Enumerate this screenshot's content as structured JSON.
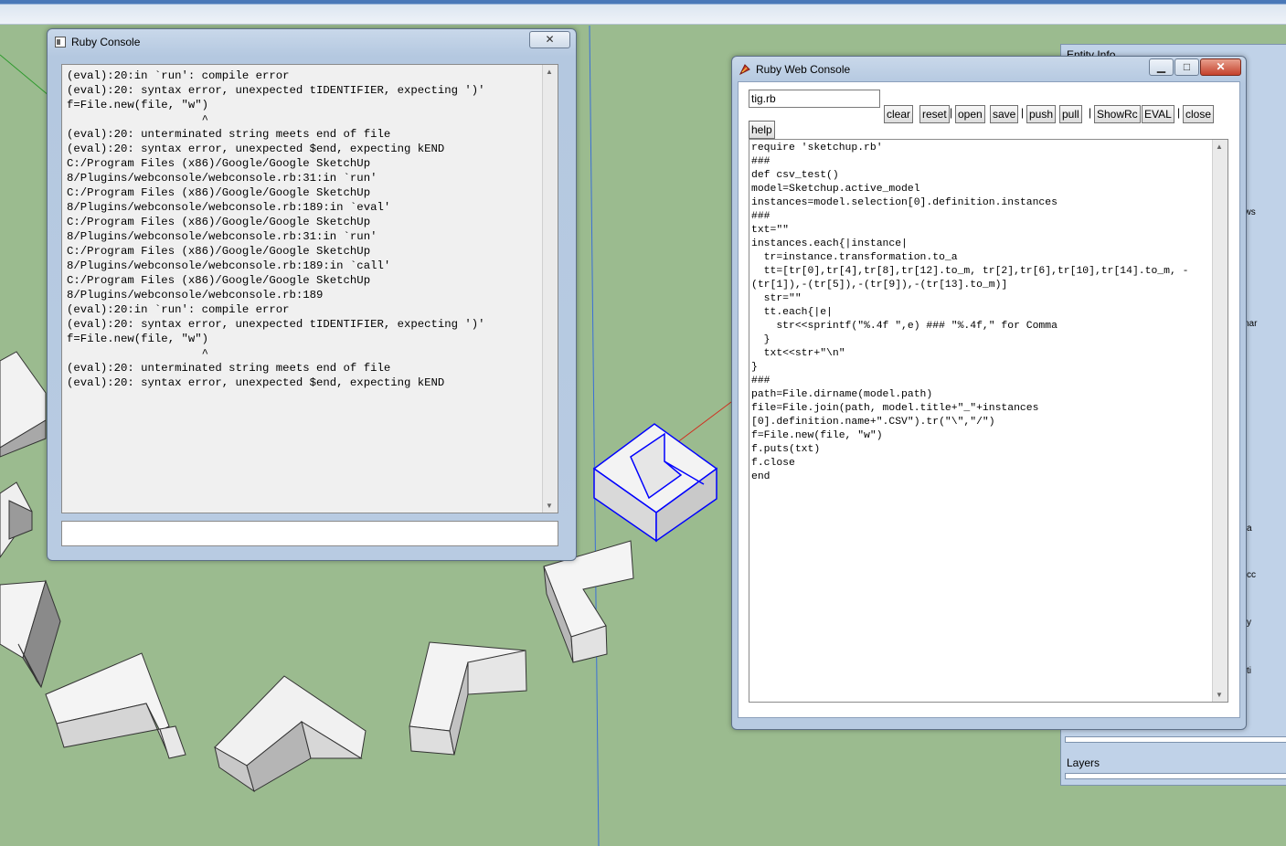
{
  "ruby_console": {
    "title": "Ruby Console",
    "close_label": "✕",
    "output_lines": [
      "(eval):20:in `run': compile error",
      "(eval):20: syntax error, unexpected tIDENTIFIER, expecting ')'",
      "f=File.new(file, \"w\")",
      "                    ^",
      "(eval):20: unterminated string meets end of file",
      "(eval):20: syntax error, unexpected $end, expecting kEND",
      "C:/Program Files (x86)/Google/Google SketchUp",
      "8/Plugins/webconsole/webconsole.rb:31:in `run'",
      "C:/Program Files (x86)/Google/Google SketchUp",
      "8/Plugins/webconsole/webconsole.rb:189:in `eval'",
      "C:/Program Files (x86)/Google/Google SketchUp",
      "8/Plugins/webconsole/webconsole.rb:31:in `run'",
      "C:/Program Files (x86)/Google/Google SketchUp",
      "8/Plugins/webconsole/webconsole.rb:189:in `call'",
      "C:/Program Files (x86)/Google/Google SketchUp",
      "8/Plugins/webconsole/webconsole.rb:189",
      "(eval):20:in `run': compile error",
      "(eval):20: syntax error, unexpected tIDENTIFIER, expecting ')'",
      "f=File.new(file, \"w\")",
      "                    ^",
      "(eval):20: unterminated string meets end of file",
      "(eval):20: syntax error, unexpected $end, expecting kEND"
    ],
    "input_value": ""
  },
  "web_console": {
    "title": "Ruby Web Console",
    "filename": "tig.rb",
    "buttons": {
      "clear": "clear",
      "reset": "reset",
      "open": "open",
      "save": "save",
      "push": "push",
      "pull": "pull",
      "showrc": "ShowRc",
      "eval": "EVAL",
      "close": "close",
      "help": "help"
    },
    "separator": "|",
    "code_lines": [
      "require 'sketchup.rb'",
      "###",
      "def csv_test()",
      "model=Sketchup.active_model",
      "instances=model.selection[0].definition.instances",
      "###",
      "txt=\"\"",
      "instances.each{|instance|",
      "  tr=instance.transformation.to_a",
      "  tt=[tr[0],tr[4],tr[8],tr[12].to_m, tr[2],tr[6],tr[10],tr[14].to_m, -",
      "(tr[1]),-(tr[5]),-(tr[9]),-(tr[13].to_m)]",
      "  str=\"\"",
      "  tt.each{|e|",
      "    str<<sprintf(\"%.4f \",e) ### \"%.4f,\" for Comma",
      "  }",
      "  txt<<str+\"\\n\"",
      "}",
      "###",
      "path=File.dirname(model.path)",
      "file=File.join(path, model.title+\"_\"+instances",
      "[0].definition.name+\".CSV\").tr(\"\\\",\"/\")",
      "f=File.new(file, \"w\")",
      "f.puts(txt)",
      "f.close",
      "end"
    ]
  },
  "side_panel": {
    "entity_info": "Entity Info",
    "layers": "Layers",
    "partial_labels": [
      "ows",
      "nar",
      "a",
      "cc",
      "y",
      "ti"
    ]
  },
  "colors": {
    "ground": "#9bbb8f",
    "selection": "#0000ff",
    "window_frame": "#b8cbe2"
  }
}
